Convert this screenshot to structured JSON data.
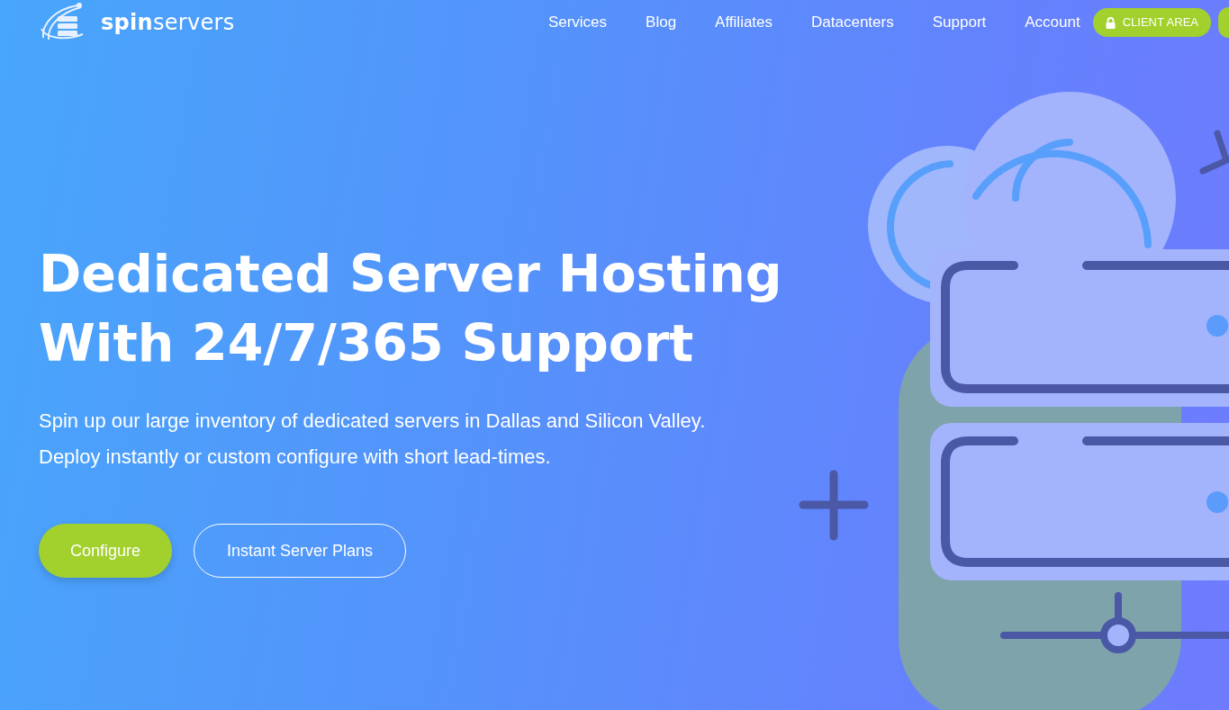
{
  "logo": {
    "text": "**spin**servers"
  },
  "nav": {
    "items": [
      "Services",
      "Blog",
      "Affiliates",
      "Datacenters",
      "Support",
      "Account"
    ],
    "client_button": "CLIENT AREA"
  },
  "hero": {
    "title_lines": [
      "Dedicated Server Hosting",
      "With 24/7/365 Support"
    ],
    "subtitle_lines": [
      "Spin up our large inventory of dedicated servers in Dallas and Silicon Valley.",
      "Deploy instantly or custom configure with short lead-times."
    ],
    "buttons": [
      {
        "label": "Configure",
        "kind": "filled"
      },
      {
        "label": "Instant Server Plans",
        "kind": "outline"
      }
    ]
  }
}
